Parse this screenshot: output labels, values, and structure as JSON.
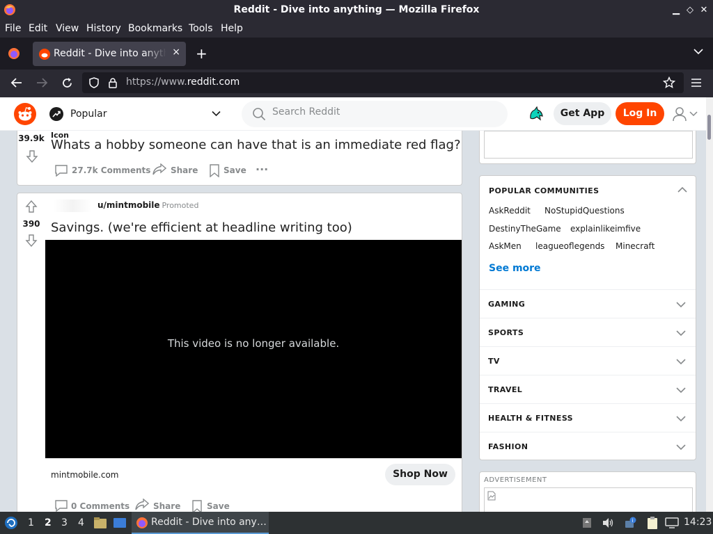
{
  "window": {
    "title": "Reddit - Dive into anything — Mozilla Firefox"
  },
  "menu": [
    "File",
    "Edit",
    "View",
    "History",
    "Bookmarks",
    "Tools",
    "Help"
  ],
  "tab": {
    "label": "Reddit - Dive into anything",
    "close": "×",
    "new_tab": "+"
  },
  "urlbar": {
    "prefix": "https://www.",
    "domain": "reddit.com"
  },
  "header": {
    "feed_label": "Popular",
    "search_placeholder": "Search Reddit",
    "get_app": "Get App",
    "log_in": "Log In"
  },
  "post1": {
    "score": "39.9k",
    "icon_text": "Icon",
    "title": "Whats a hobby someone can have that is an immediate red flag?",
    "comments": "27.7k Comments",
    "share": "Share",
    "save": "Save",
    "more": "···"
  },
  "post2": {
    "score": "390",
    "user": "u/mintmobile",
    "promoted": "Promoted",
    "title": "Savings. (we're efficient at headline writing too)",
    "video_message": "This video is no longer available.",
    "domain": "mintmobile.com",
    "shop_now": "Shop Now",
    "comments": "0 Comments",
    "share": "Share",
    "save": "Save"
  },
  "sidebar": {
    "popular_communities_title": "POPULAR COMMUNITIES",
    "communities": [
      "AskReddit",
      "NoStupidQuestions",
      "DestinyTheGame",
      "explainlikeimfive",
      "AskMen",
      "leagueoflegends",
      "Minecraft"
    ],
    "see_more": "See more",
    "topics": [
      "GAMING",
      "SPORTS",
      "TV",
      "TRAVEL",
      "HEALTH & FITNESS",
      "FASHION"
    ],
    "advertisement": "ADVERTISEMENT"
  },
  "taskbar": {
    "workspaces": [
      "1",
      "2",
      "3",
      "4"
    ],
    "active_workspace": "2",
    "task_label": "Reddit - Dive into any…",
    "clock": "14:23"
  },
  "colors": {
    "reddit_orange": "#ff4500",
    "link_blue": "#0079d3",
    "chrome_dark": "#2b2a33"
  }
}
